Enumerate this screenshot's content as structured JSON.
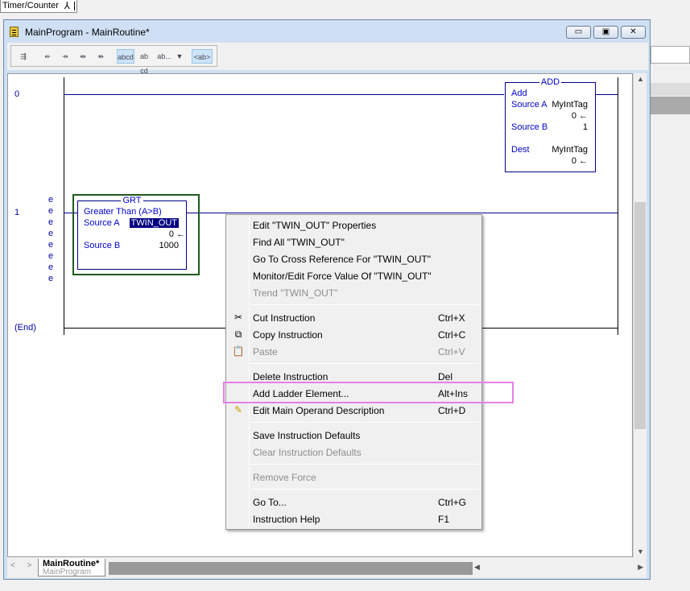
{
  "top_tab": {
    "label": "Timer/Counter"
  },
  "window": {
    "title": "MainProgram - MainRoutine*",
    "buttons": {
      "minimize": "▭",
      "restore": "▣",
      "close": "✕"
    }
  },
  "toolbar": {
    "items": [
      "⇶",
      "⇷",
      "⇸",
      "⇹",
      "⇻",
      "abcd",
      "ab cd",
      "ab...",
      "▼",
      "<ab>"
    ]
  },
  "ladder": {
    "rungs": [
      {
        "number": "0"
      },
      {
        "number": "1"
      }
    ],
    "end_label": "(End)",
    "e_marks": [
      "e",
      "e",
      "e",
      "e",
      "e",
      "e",
      "e",
      "e"
    ],
    "add": {
      "header": "ADD",
      "name": "Add",
      "source_a_label": "Source A",
      "source_a_tag": "MyIntTag",
      "source_a_value": "0",
      "source_b_label": "Source B",
      "source_b_value": "1",
      "dest_label": "Dest",
      "dest_tag": "MyIntTag",
      "dest_value": "0"
    },
    "grt": {
      "header": "GRT",
      "name": "Greater Than (A>B)",
      "source_a_label": "Source A",
      "source_a_tag": "TWIN_OUT",
      "source_a_value": "0",
      "source_b_label": "Source B",
      "source_b_value": "1000"
    }
  },
  "bottom": {
    "arrows": "< >",
    "routine_tab": "MainRoutine*",
    "program_tab": "MainProgram"
  },
  "context_menu": {
    "items": [
      {
        "label": "Edit \"TWIN_OUT\" Properties",
        "shortcut": ""
      },
      {
        "label": "Find All \"TWIN_OUT\"",
        "shortcut": ""
      },
      {
        "label": "Go To Cross Reference For \"TWIN_OUT\"",
        "shortcut": ""
      },
      {
        "label": "Monitor/Edit Force Value Of \"TWIN_OUT\"",
        "shortcut": ""
      },
      {
        "label": "Trend \"TWIN_OUT\"",
        "shortcut": ""
      },
      {
        "label": "Cut Instruction",
        "shortcut": "Ctrl+X"
      },
      {
        "label": "Copy Instruction",
        "shortcut": "Ctrl+C"
      },
      {
        "label": "Paste",
        "shortcut": "Ctrl+V"
      },
      {
        "label": "Delete Instruction",
        "shortcut": "Del"
      },
      {
        "label": "Add Ladder Element...",
        "shortcut": "Alt+Ins"
      },
      {
        "label": "Edit Main Operand Description",
        "shortcut": "Ctrl+D"
      },
      {
        "label": "Save Instruction Defaults",
        "shortcut": ""
      },
      {
        "label": "Clear Instruction Defaults",
        "shortcut": ""
      },
      {
        "label": "Remove Force",
        "shortcut": ""
      },
      {
        "label": "Go To...",
        "shortcut": "Ctrl+G"
      },
      {
        "label": "Instruction Help",
        "shortcut": "F1"
      }
    ]
  }
}
